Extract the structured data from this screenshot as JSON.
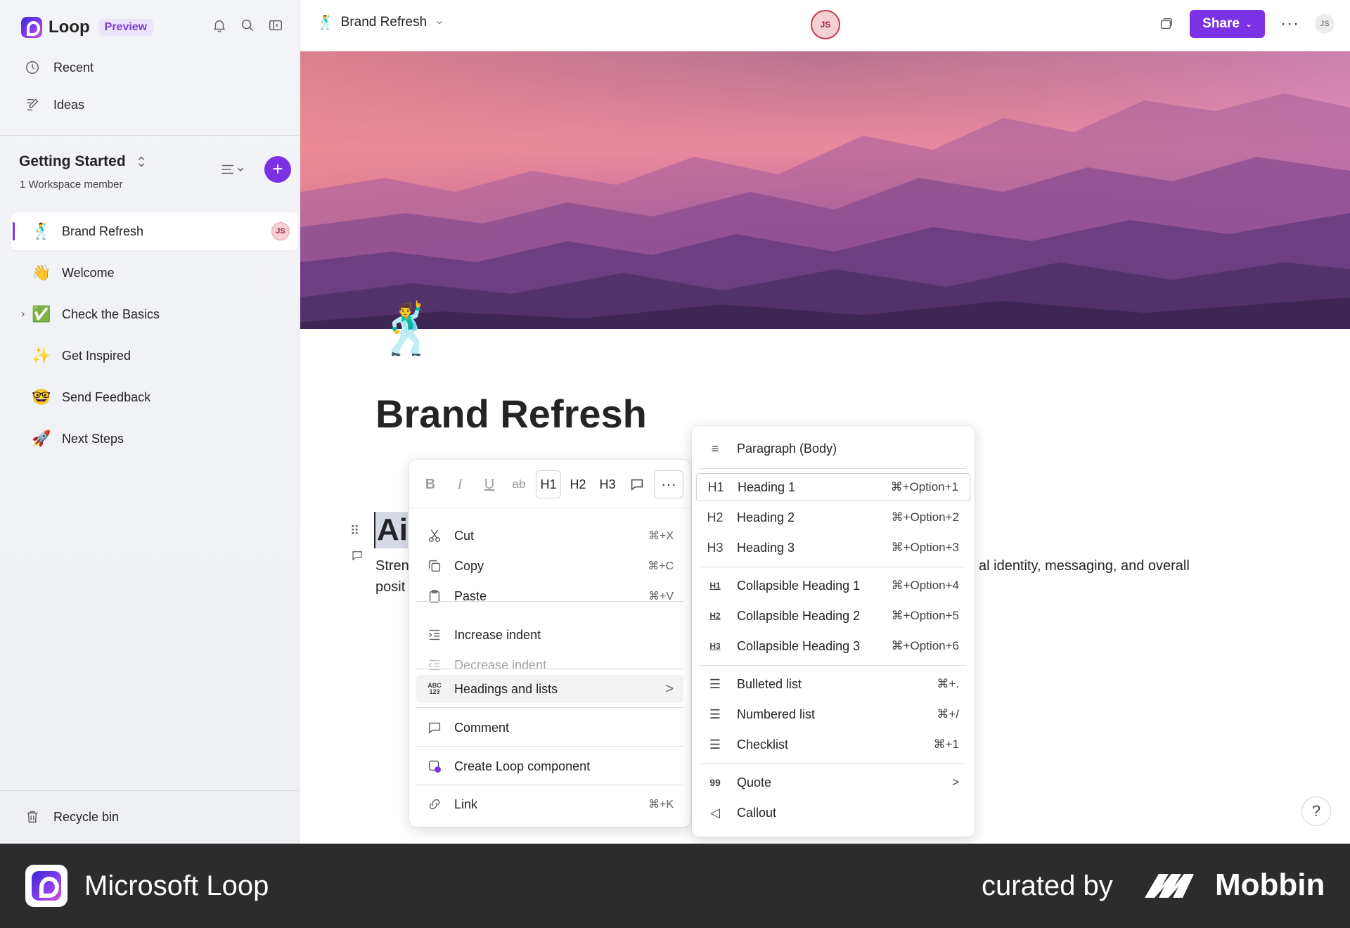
{
  "sidebar": {
    "brand": "Loop",
    "badge": "Preview",
    "nav": [
      {
        "label": "Recent"
      },
      {
        "label": "Ideas"
      }
    ],
    "workspace": {
      "title": "Getting Started",
      "subtitle": "1 Workspace member"
    },
    "pages": [
      {
        "emoji": "🕺",
        "label": "Brand Refresh",
        "avatar": "JS"
      },
      {
        "emoji": "👋",
        "label": "Welcome"
      },
      {
        "emoji": "✅",
        "label": "Check the Basics",
        "expandable": true
      },
      {
        "emoji": "✨",
        "label": "Get Inspired"
      },
      {
        "emoji": "🤓",
        "label": "Send Feedback"
      },
      {
        "emoji": "🚀",
        "label": "Next Steps"
      }
    ],
    "recycle": "Recycle bin"
  },
  "topbar": {
    "doc_emoji": "🕺",
    "doc_title": "Brand Refresh",
    "presence_avatar": "JS",
    "share_label": "Share",
    "more": "···",
    "user_avatar": "JS"
  },
  "document": {
    "emoji": "🕺",
    "title": "Brand Refresh",
    "heading_partial": "Ai",
    "body_left_line1": "Stren",
    "body_left_line2": "posit",
    "body_right": "al identity, messaging, and overall"
  },
  "format_bar": {
    "bold": "B",
    "italic": "I",
    "underline": "U",
    "strike": "ab",
    "h1": "H1",
    "h2": "H2",
    "h3": "H3",
    "more": "···"
  },
  "context_menu": [
    {
      "label": "Cut",
      "shortcut": "⌘+X"
    },
    {
      "label": "Copy",
      "shortcut": "⌘+C"
    },
    {
      "label": "Paste",
      "shortcut": "⌘+V"
    },
    {
      "label": "Increase indent",
      "shortcut": ""
    },
    {
      "label": "Decrease indent",
      "shortcut": "",
      "disabled": true
    },
    {
      "label": "Headings and lists",
      "shortcut": ">"
    },
    {
      "label": "Comment",
      "shortcut": ""
    },
    {
      "label": "Create Loop component",
      "shortcut": ""
    },
    {
      "label": "Link",
      "shortcut": "⌘+K"
    }
  ],
  "submenu": [
    {
      "lead": "≡",
      "label": "Paragraph (Body)",
      "shortcut": ""
    },
    {
      "lead": "H1",
      "label": "Heading 1",
      "shortcut": "⌘+Option+1"
    },
    {
      "lead": "H2",
      "label": "Heading 2",
      "shortcut": "⌘+Option+2"
    },
    {
      "lead": "H3",
      "label": "Heading 3",
      "shortcut": "⌘+Option+3"
    },
    {
      "lead": "H1",
      "label": "Collapsible Heading 1",
      "shortcut": "⌘+Option+4"
    },
    {
      "lead": "H2",
      "label": "Collapsible Heading 2",
      "shortcut": "⌘+Option+5"
    },
    {
      "lead": "H3",
      "label": "Collapsible Heading 3",
      "shortcut": "⌘+Option+6"
    },
    {
      "lead": "☰",
      "label": "Bulleted list",
      "shortcut": "⌘+."
    },
    {
      "lead": "☰",
      "label": "Numbered list",
      "shortcut": "⌘+/"
    },
    {
      "lead": "☰",
      "label": "Checklist",
      "shortcut": "⌘+1"
    },
    {
      "lead": "99",
      "label": "Quote",
      "shortcut": ">"
    },
    {
      "lead": "◁",
      "label": "Callout",
      "shortcut": ""
    }
  ],
  "help": "?",
  "footer": {
    "app_name": "Microsoft Loop",
    "curated": "curated by",
    "mobbin": "Mobbin"
  },
  "colors": {
    "accent": "#7b32e4",
    "footer_bg": "#2c2c2c"
  }
}
